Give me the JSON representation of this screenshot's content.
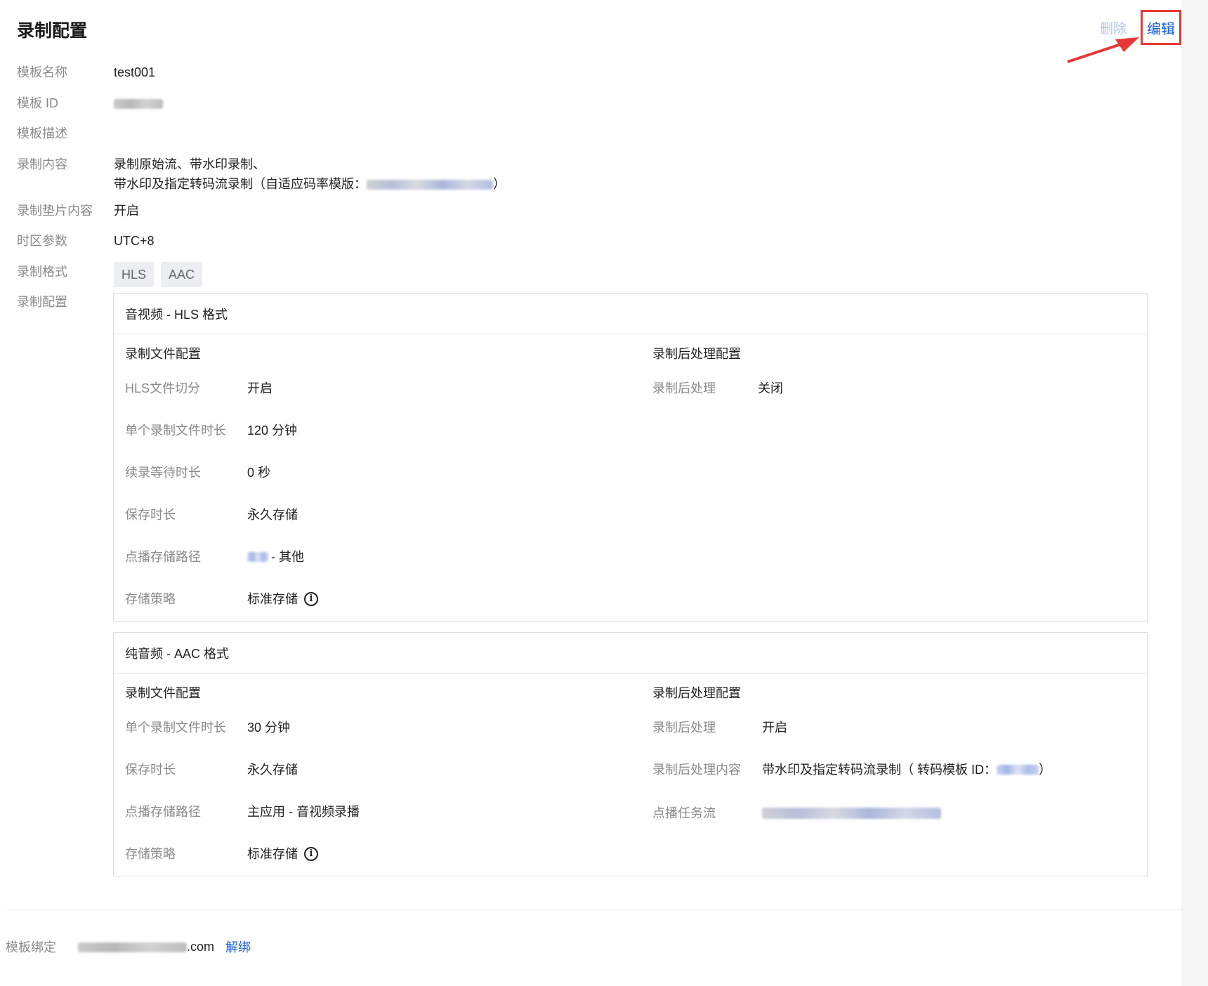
{
  "header": {
    "title": "录制配置",
    "delete_label": "删除",
    "edit_label": "编辑"
  },
  "info": {
    "name_label": "模板名称",
    "name_value": "test001",
    "id_label": "模板 ID",
    "desc_label": "模板描述",
    "content_label": "录制内容",
    "content_line1": "录制原始流、带水印录制、",
    "content_line2_prefix": "带水印及指定转码流录制（自适应码率模版：",
    "content_line2_suffix": "）",
    "pad_label": "录制垫片内容",
    "pad_value": "开启",
    "tz_label": "时区参数",
    "tz_value": "UTC+8",
    "format_label": "录制格式",
    "formats": [
      "HLS",
      "AAC"
    ],
    "config_label": "录制配置"
  },
  "hls_section": {
    "title": "音视频 - HLS 格式",
    "file_config_title": "录制文件配置",
    "post_config_title": "录制后处理配置",
    "fields": [
      {
        "label": "HLS文件切分",
        "value": "开启"
      },
      {
        "label": "单个录制文件时长",
        "value": "120 分钟"
      },
      {
        "label": "续录等待时长",
        "value": "0 秒"
      },
      {
        "label": "保存时长",
        "value": "永久存储"
      },
      {
        "label": "点播存储路径",
        "value": "- 其他"
      },
      {
        "label": "存储策略",
        "value": "标准存储"
      }
    ],
    "post_fields": [
      {
        "label": "录制后处理",
        "value": "关闭"
      }
    ]
  },
  "aac_section": {
    "title": "纯音频 - AAC 格式",
    "file_config_title": "录制文件配置",
    "post_config_title": "录制后处理配置",
    "fields": [
      {
        "label": "单个录制文件时长",
        "value": "30 分钟"
      },
      {
        "label": "保存时长",
        "value": "永久存储"
      },
      {
        "label": "点播存储路径",
        "value": "主应用 - 音视频录播"
      },
      {
        "label": "存储策略",
        "value": "标准存储"
      }
    ],
    "post_fields": [
      {
        "label": "录制后处理",
        "value": "开启"
      },
      {
        "label": "录制后处理内容",
        "value_prefix": "带水印及指定转码流录制（ 转码模板 ID：",
        "value_suffix": "）"
      },
      {
        "label": "点播任务流",
        "value": ""
      }
    ]
  },
  "binding": {
    "label": "模板绑定",
    "domain_suffix": ".com",
    "unbind_label": "解绑"
  },
  "icons": {
    "info": "info-icon",
    "arrow": "red-arrow-annotation"
  },
  "colors": {
    "link": "#1a5fd1",
    "delete_disabled": "#a9c4f0",
    "highlight_border": "#e53935"
  }
}
